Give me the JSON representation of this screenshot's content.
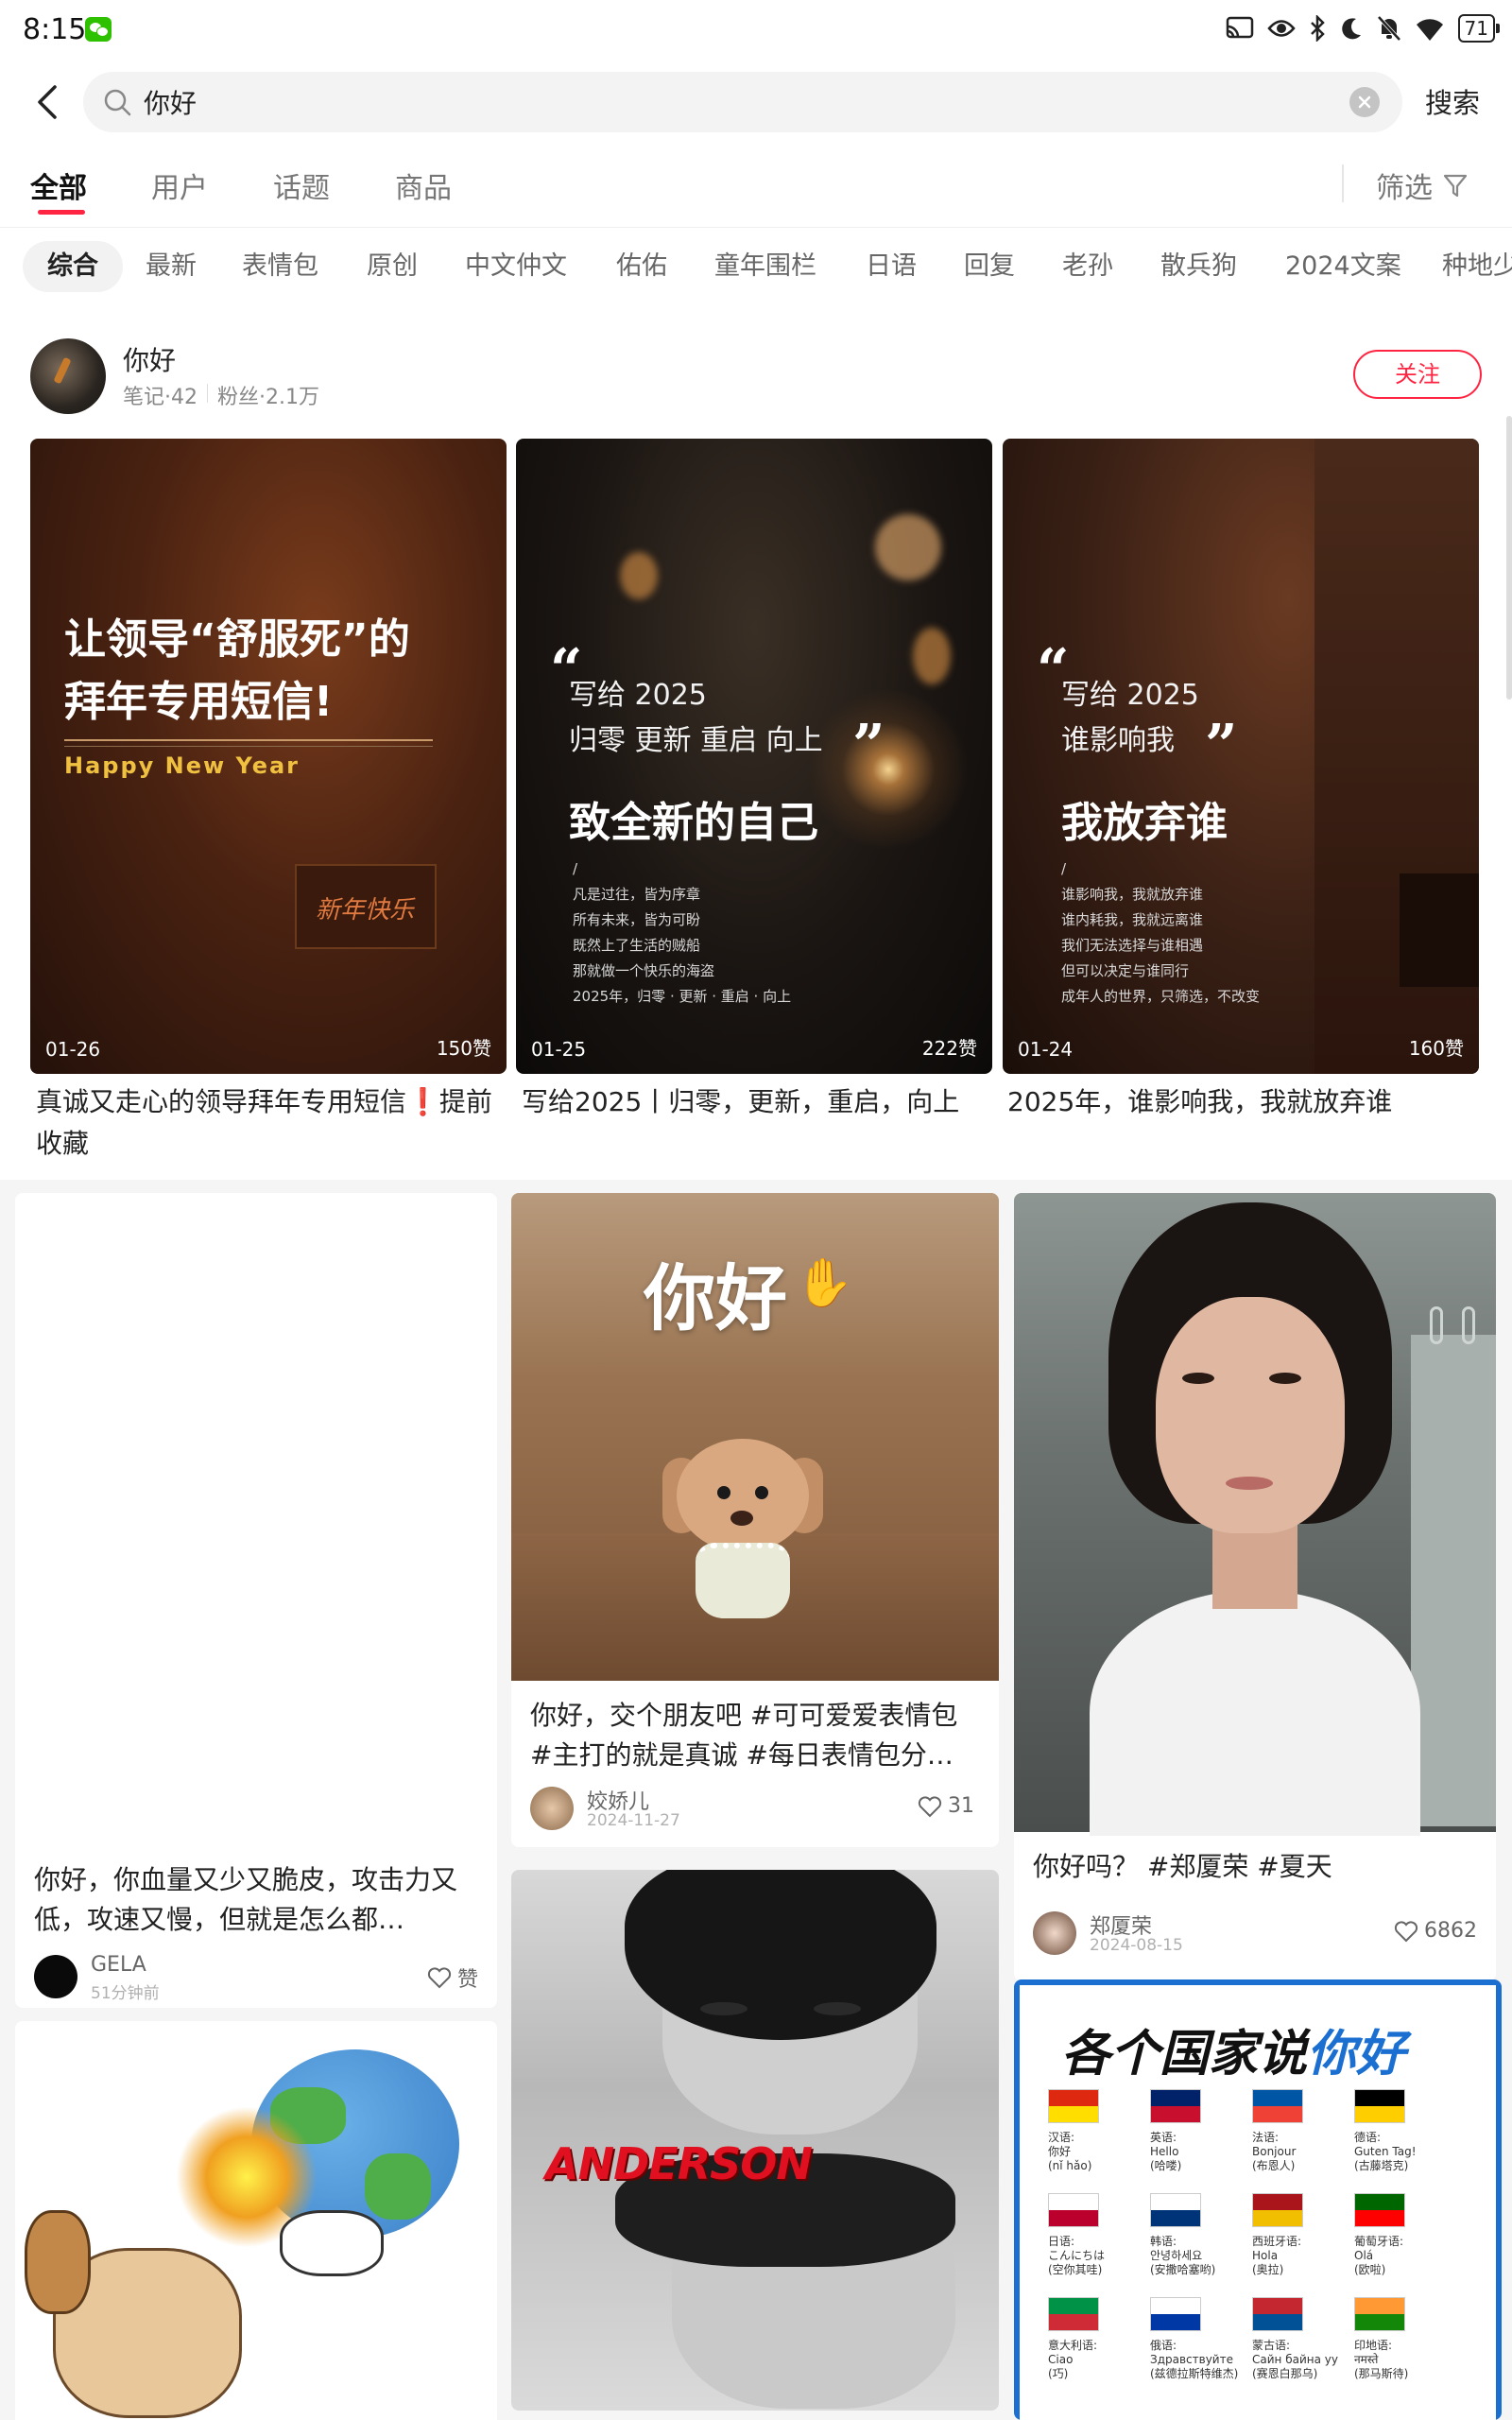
{
  "status_bar": {
    "time": "8:15",
    "battery": "71"
  },
  "search": {
    "query": "你好",
    "button_label": "搜索"
  },
  "tabs": {
    "items": [
      {
        "label": "全部",
        "active": true
      },
      {
        "label": "用户",
        "active": false
      },
      {
        "label": "话题",
        "active": false
      },
      {
        "label": "商品",
        "active": false
      }
    ],
    "filter_label": "筛选"
  },
  "chips": [
    {
      "label": "综合",
      "active": true
    },
    {
      "label": "最新"
    },
    {
      "label": "表情包"
    },
    {
      "label": "原创"
    },
    {
      "label": "中文仲文"
    },
    {
      "label": "佑佑"
    },
    {
      "label": "童年围栏"
    },
    {
      "label": "日语"
    },
    {
      "label": "回复"
    },
    {
      "label": "老孙"
    },
    {
      "label": "散兵狗"
    },
    {
      "label": "2024文案"
    },
    {
      "label": "种地少"
    }
  ],
  "user": {
    "name": "你好",
    "notes": "笔记·42",
    "fans": "粉丝·2.1万",
    "follow_label": "关注"
  },
  "user_notes": [
    {
      "date": "01-26",
      "likes": "150赞",
      "title": "真诚又走心的领导拜年专用短信❗️提前收藏",
      "image_text": {
        "headline_1": "让领导“舒服死”的",
        "headline_2": "拜年专用短信!",
        "subline": "Happy New Year",
        "sign": "新年快乐"
      }
    },
    {
      "date": "01-25",
      "likes": "222赞",
      "title": "写给2025丨归零，更新，重启，向上",
      "image_text": {
        "quote_1": "写给 2025",
        "quote_2": "归零 更新 重启 向上",
        "big": "致全新的自己",
        "lines": [
          "/",
          "凡是过往，皆为序章",
          "所有未来，皆为可盼",
          "既然上了生活的贼船",
          "那就做一个快乐的海盗",
          "2025年，归零 · 更新 · 重启 · 向上"
        ]
      }
    },
    {
      "date": "01-24",
      "likes": "160赞",
      "title": "2025年，谁影响我，我就放弃谁",
      "image_text": {
        "quote_1": "写给 2025",
        "quote_2": "谁影响我",
        "big": "我放弃谁",
        "lines": [
          "/",
          "谁影响我，我就放弃谁",
          "谁内耗我，我就远离谁",
          "我们无法选择与谁相遇",
          "但可以决定与谁同行",
          "成年人的世界，只筛选，不改变"
        ]
      }
    }
  ],
  "feed": {
    "col1": [
      {
        "title": "你好，你血量又少又脆皮，攻击力又低，攻速又慢，但就是怎么都…",
        "author": "GELA",
        "time": "51分钟前",
        "likes": "赞"
      }
    ],
    "col2": [
      {
        "image_text": "你好",
        "title": "你好，交个朋友吧 #可可爱爱表情包 #主打的就是真诚 #每日表情包分…",
        "author": "姣娇儿",
        "time": "2024-11-27",
        "likes": "31"
      },
      {
        "image_text": "ANDERSON"
      }
    ],
    "col3": [
      {
        "title": "你好吗？ #郑厦荣 #夏天",
        "author": "郑厦荣",
        "time": "2024-08-15",
        "likes": "6862"
      },
      {
        "image_title_1": "各个国家说",
        "image_title_2": "你好",
        "flags": [
          {
            "lang": "汉语:",
            "word": "你好",
            "pron": "(nǐ hǎo)",
            "colors": [
              "#de2910",
              "#ffde00"
            ]
          },
          {
            "lang": "英语:",
            "word": "Hello",
            "pron": "(哈喽)",
            "colors": [
              "#012169",
              "#c8102e"
            ]
          },
          {
            "lang": "法语:",
            "word": "Bonjour",
            "pron": "(布恩人)",
            "colors": [
              "#0055a4",
              "#ef4135"
            ]
          },
          {
            "lang": "德语:",
            "word": "Guten Tag!",
            "pron": "(古藤塔克)",
            "colors": [
              "#000000",
              "#ffce00"
            ]
          },
          {
            "lang": "日语:",
            "word": "こんにちは",
            "pron": "(空你其哇)",
            "colors": [
              "#ffffff",
              "#bc002d"
            ]
          },
          {
            "lang": "韩语:",
            "word": "안녕하세요",
            "pron": "(安撒哈塞哟)",
            "colors": [
              "#ffffff",
              "#003478"
            ]
          },
          {
            "lang": "西班牙语:",
            "word": "Hola",
            "pron": "(奥拉)",
            "colors": [
              "#aa151b",
              "#f1bf00"
            ]
          },
          {
            "lang": "葡萄牙语:",
            "word": "Olá",
            "pron": "(欧啦)",
            "colors": [
              "#006600",
              "#ff0000"
            ]
          },
          {
            "lang": "意大利语:",
            "word": "Ciao",
            "pron": "(巧)",
            "colors": [
              "#009246",
              "#ce2b37"
            ]
          },
          {
            "lang": "俄语:",
            "word": "Здравствуйте",
            "pron": "(兹德拉斯特维杰)",
            "colors": [
              "#ffffff",
              "#0039a6"
            ]
          },
          {
            "lang": "蒙古语:",
            "word": "Сайн байна уу",
            "pron": "(赛恩白那乌)",
            "colors": [
              "#c4272f",
              "#015197"
            ]
          },
          {
            "lang": "印地语:",
            "word": "नमस्ते",
            "pron": "(那马斯待)",
            "colors": [
              "#ff9933",
              "#138808"
            ]
          }
        ]
      }
    ]
  }
}
